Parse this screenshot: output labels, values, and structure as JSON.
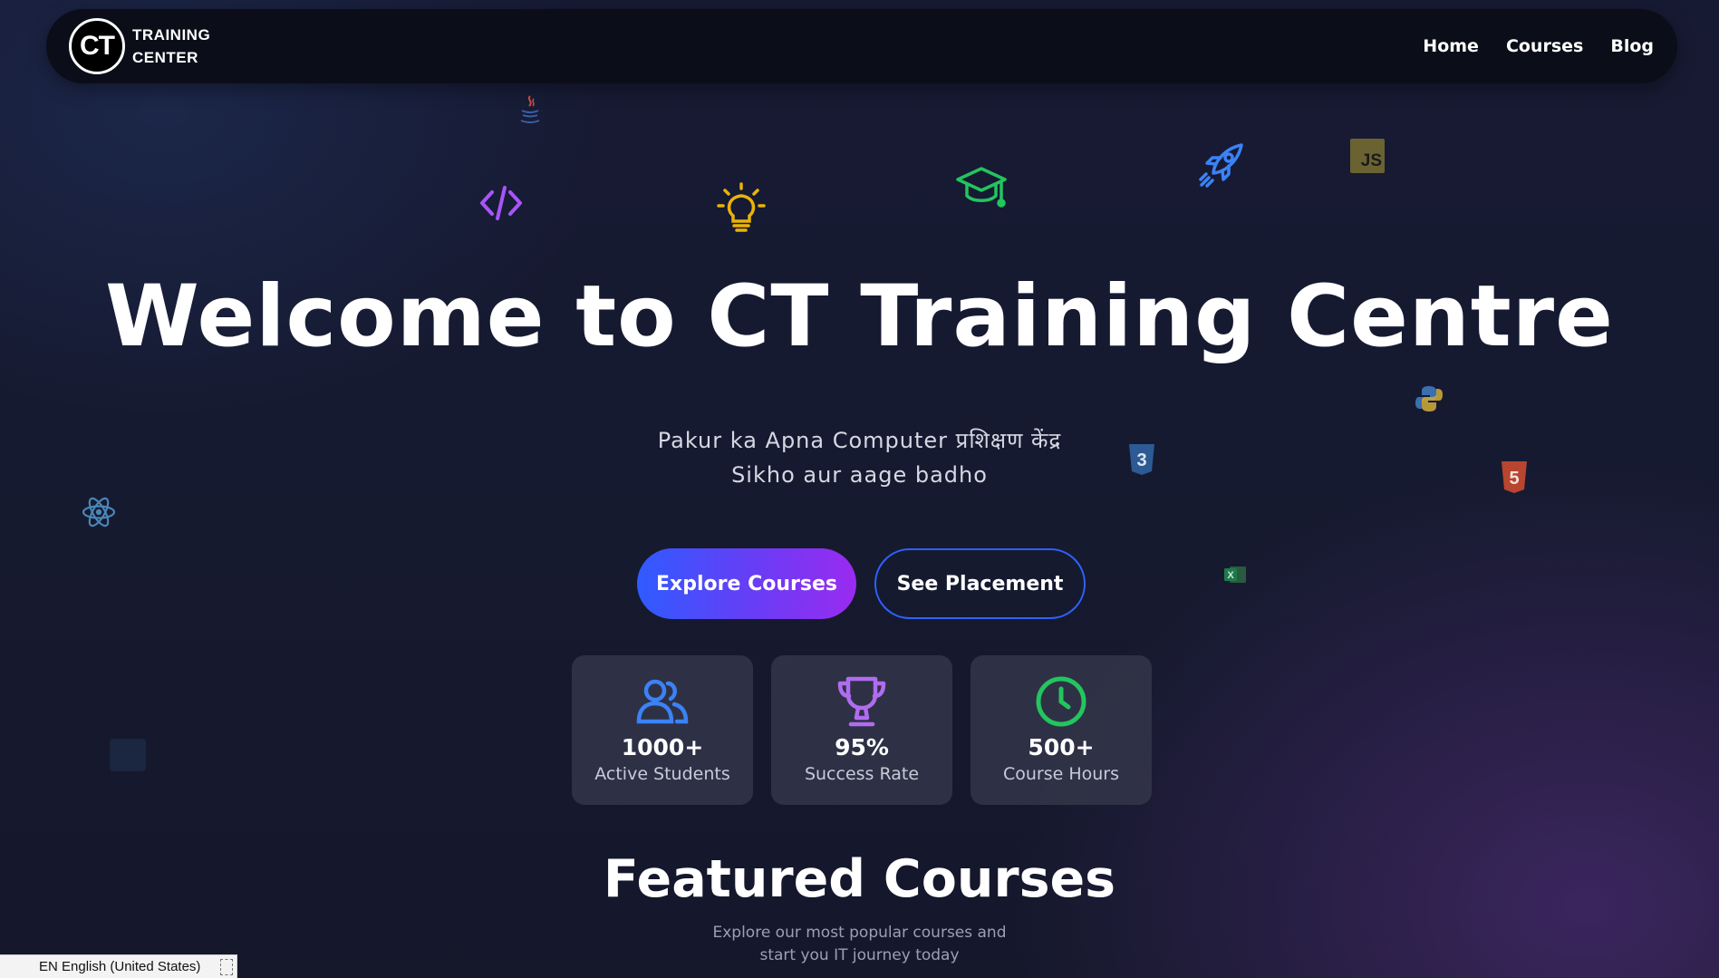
{
  "nav": {
    "logo_text": "CT",
    "brand_line1": "TRAINING",
    "brand_line2": "CENTER",
    "links": [
      "Home",
      "Courses",
      "Blog"
    ]
  },
  "hero": {
    "title": "Welcome to CT Training Centre",
    "subtitle_line1": "Pakur ka Apna Computer प्रशिक्षण केंद्र",
    "subtitle_line2": "Sikho aur aage badho",
    "primary_button": "Explore Courses",
    "secondary_button": "See Placement"
  },
  "floating_icons": [
    "java-icon",
    "code-icon",
    "lightbulb-icon",
    "graduation-cap-icon",
    "rocket-icon",
    "javascript-icon",
    "python-icon",
    "css3-icon",
    "html5-icon",
    "react-icon",
    "excel-icon",
    "dark-square-icon"
  ],
  "floating_icon_text": {
    "javascript": "JS",
    "css3": "3",
    "html5": "5",
    "excel": "X"
  },
  "stats": [
    {
      "value": "1000+",
      "label": "Active Students",
      "icon": "users-icon",
      "color": "#3b82f6"
    },
    {
      "value": "95%",
      "label": "Success Rate",
      "icon": "trophy-icon",
      "color": "#b06cf0"
    },
    {
      "value": "500+",
      "label": "Course Hours",
      "icon": "clock-icon",
      "color": "#22c55e"
    }
  ],
  "featured": {
    "title": "Featured Courses",
    "subtitle_line1": "Explore our most popular courses and",
    "subtitle_line2": "start you IT journey today"
  },
  "language_bar": {
    "text": "EN English (United States)"
  },
  "colors": {
    "accent_blue": "#2f5bff",
    "accent_purple": "#9a2bf0",
    "nav_bg": "#0b0d18",
    "page_bg": "#161a30"
  }
}
